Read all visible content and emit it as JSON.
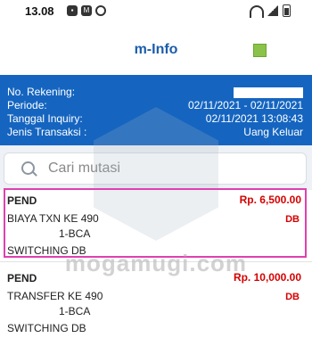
{
  "status_bar": {
    "time": "13.08",
    "left_icons": [
      "notification-icon",
      "m-icon",
      "whatsapp-icon"
    ],
    "right_icons": [
      "wifi-icon",
      "signal-icon",
      "battery-icon"
    ]
  },
  "header": {
    "title": "m-Info",
    "indicator_color": "#8bc34a"
  },
  "info": {
    "account_label": "No. Rekening:",
    "period_label": "Periode:",
    "period_value": "02/11/2021 - 02/11/2021",
    "inquiry_label": "Tanggal Inquiry:",
    "inquiry_value": "02/11/2021 13:08:43",
    "type_label": "Jenis Transaksi :",
    "type_value": "Uang Keluar"
  },
  "search": {
    "placeholder": "Cari mutasi"
  },
  "transactions": [
    {
      "type": "PEND",
      "amount": "Rp. 6,500.00",
      "desc1": "BIAYA TXN  KE 490",
      "desc2": "1-BCA",
      "desc3": "SWITCHING DB",
      "dc": "DB",
      "selected": true
    },
    {
      "type": "PEND",
      "amount": "Rp. 10,000.00",
      "desc1": "TRANSFER   KE 490",
      "desc2": "1-BCA",
      "desc3": "SWITCHING DB",
      "dc": "DB",
      "selected": false
    }
  ],
  "watermark": "mogamugi.com",
  "colors": {
    "primary": "#1565c0",
    "title": "#1b5cab",
    "amount": "#d50000",
    "selection": "#e040b0"
  }
}
